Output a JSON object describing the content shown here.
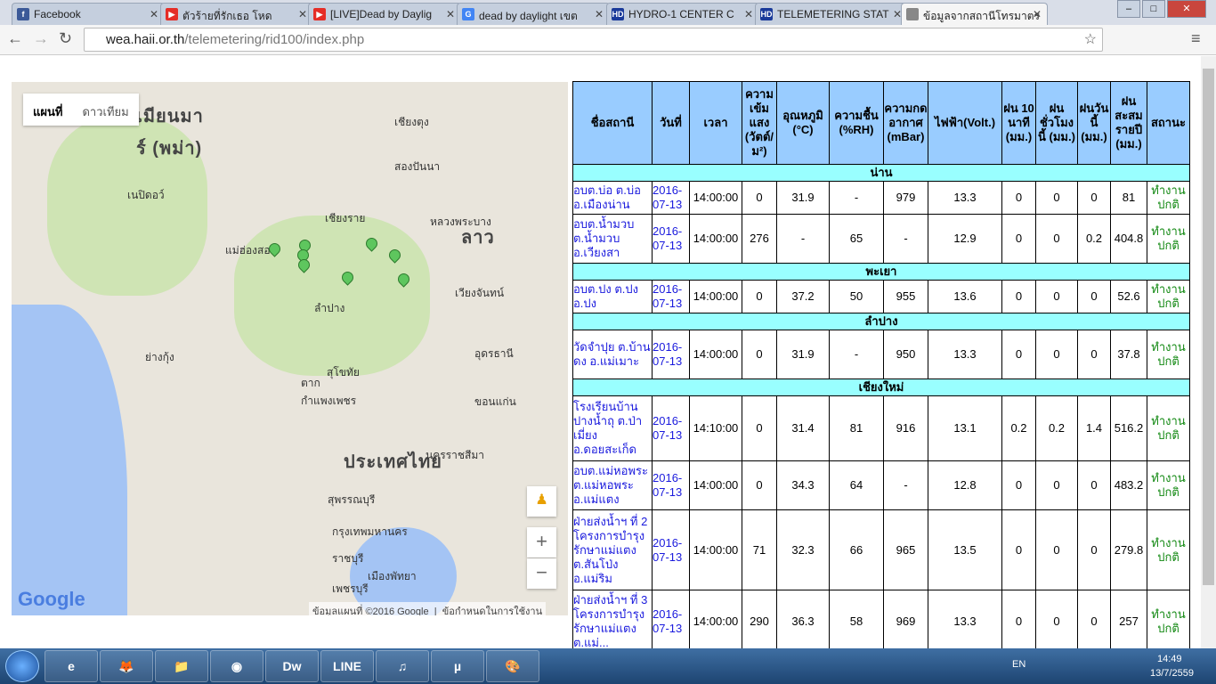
{
  "browser": {
    "tabs": [
      {
        "title": "Facebook",
        "icon": "facebook-icon",
        "color": "#3b5998",
        "glyph": "f"
      },
      {
        "title": "ตัวร้ายที่รักเธอ โหด",
        "icon": "youtube-icon",
        "color": "#e52d27",
        "glyph": "▶"
      },
      {
        "title": "[LIVE]Dead by Daylig",
        "icon": "youtube-icon",
        "color": "#e52d27",
        "glyph": "▶"
      },
      {
        "title": "dead by daylight เขต",
        "icon": "google-icon",
        "color": "#4285f4",
        "glyph": "G"
      },
      {
        "title": "HYDRO-1 CENTER C",
        "icon": "hd-one-icon",
        "color": "#1a3a9a",
        "glyph": "HD"
      },
      {
        "title": "TELEMETERING STAT",
        "icon": "hd-one-icon",
        "color": "#1a3a9a",
        "glyph": "HD"
      },
      {
        "title": "ข้อมูลจากสถานีโทรมาตร",
        "icon": "page-icon",
        "color": "#888888",
        "glyph": ""
      }
    ],
    "url_domain": "wea.haii.or.th",
    "url_path": "/telemetering/rid100/index.php"
  },
  "map": {
    "type_buttons": [
      "แผนที่",
      "ดาวเทียม"
    ],
    "labels": [
      {
        "t": "เมียนมา",
        "c": "big"
      },
      {
        "t": "ร์ (พม่า)",
        "c": "big"
      },
      {
        "t": "ลาว",
        "c": "big"
      },
      {
        "t": "ประเทศไทย",
        "c": "big"
      },
      {
        "t": "เนปิดอว์",
        "c": ""
      },
      {
        "t": "เชียงราย",
        "c": ""
      },
      {
        "t": "ลำปาง",
        "c": ""
      },
      {
        "t": "แม่ฮ่องสอน",
        "c": ""
      },
      {
        "t": "เวียงจันทน์",
        "c": ""
      },
      {
        "t": "อุดรธานี",
        "c": ""
      },
      {
        "t": "สุโขทัย",
        "c": ""
      },
      {
        "t": "ตาก",
        "c": ""
      },
      {
        "t": "กำแพงเพชร",
        "c": ""
      },
      {
        "t": "ขอนแก่น",
        "c": ""
      },
      {
        "t": "นครราชสีมา",
        "c": ""
      },
      {
        "t": "สุพรรณบุรี",
        "c": ""
      },
      {
        "t": "กรุงเทพมหานคร",
        "c": ""
      },
      {
        "t": "ราชบุรี",
        "c": ""
      },
      {
        "t": "เมืองพัทยา",
        "c": ""
      },
      {
        "t": "เพชรบุรี",
        "c": ""
      },
      {
        "t": "ย่างกุ้ง",
        "c": ""
      },
      {
        "t": "หลวงพระบาง",
        "c": ""
      },
      {
        "t": "เชียงตุง",
        "c": ""
      },
      {
        "t": "สองปันนา",
        "c": ""
      }
    ],
    "attribution": "ข้อมูลแผนที่ ©2016 Google",
    "terms": "ข้อกำหนดในการใช้งาน",
    "logo": "Google",
    "zoom_in": "+",
    "zoom_out": "−"
  },
  "table": {
    "headers": [
      "ชื่อสถานี",
      "วันที่",
      "เวลา",
      "ความเข้มแสง (วัตต์/ม²)",
      "อุณหภูมิ (°C)",
      "ความชื้น (%RH)",
      "ความกดอากาศ (mBar)",
      "ไฟฟ้า(Volt.)",
      "ฝน 10 นาที (มม.)",
      "ฝนชั่วโมงนี้ (มม.)",
      "ฝนวันนี้ (มม.)",
      "ฝนสะสมรายปี (มม.)",
      "สถานะ"
    ],
    "groups": [
      {
        "name": "น่าน",
        "rows": [
          [
            "อบต.บ่อ ต.บ่อ อ.เมืองน่าน",
            "2016-07-13",
            "14:00:00",
            "0",
            "31.9",
            "-",
            "979",
            "13.3",
            "0",
            "0",
            "0",
            "81",
            "ทำงานปกติ"
          ],
          [
            "อบต.น้ำมวบ ต.น้ำมวบ อ.เวียงสา",
            "2016-07-13",
            "14:00:00",
            "276",
            "-",
            "65",
            "-",
            "12.9",
            "0",
            "0",
            "0.2",
            "404.8",
            "ทำงานปกติ"
          ]
        ]
      },
      {
        "name": "พะเยา",
        "rows": [
          [
            "อบต.ปง ต.ปง อ.ปง",
            "2016-07-13",
            "14:00:00",
            "0",
            "37.2",
            "50",
            "955",
            "13.6",
            "0",
            "0",
            "0",
            "52.6",
            "ทำงานปกติ"
          ]
        ]
      },
      {
        "name": "ลำปาง",
        "rows": [
          [
            "วัดจำปุย ต.บ้านดง อ.แม่เมาะ",
            "2016-07-13",
            "14:00:00",
            "0",
            "31.9",
            "-",
            "950",
            "13.3",
            "0",
            "0",
            "0",
            "37.8",
            "ทำงานปกติ"
          ]
        ]
      },
      {
        "name": "เชียงใหม่",
        "rows": [
          [
            "โรงเรียนบ้านปางน้ำถุ ต.ป่าเมี่ยง อ.ดอยสะเก็ด",
            "2016-07-13",
            "14:10:00",
            "0",
            "31.4",
            "81",
            "916",
            "13.1",
            "0.2",
            "0.2",
            "1.4",
            "516.2",
            "ทำงานปกติ"
          ],
          [
            "อบต.แม่หอพระ ต.แม่หอพระ อ.แม่แตง",
            "2016-07-13",
            "14:00:00",
            "0",
            "34.3",
            "64",
            "-",
            "12.8",
            "0",
            "0",
            "0",
            "483.2",
            "ทำงานปกติ"
          ],
          [
            "ฝ่ายส่งน้ำฯ ที่ 2 โครงการบำรุงรักษาแม่แตง ต.สันโป่ง อ.แม่ริม",
            "2016-07-13",
            "14:00:00",
            "71",
            "32.3",
            "66",
            "965",
            "13.5",
            "0",
            "0",
            "0",
            "279.8",
            "ทำงานปกติ"
          ],
          [
            "ฝ่ายส่งน้ำฯ ที่ 3 โครงการบำรุงรักษาแม่แตง ต.แม่...",
            "2016-07-13",
            "14:00:00",
            "290",
            "36.3",
            "58",
            "969",
            "13.3",
            "0",
            "0",
            "0",
            "257",
            "ทำงานปกติ"
          ]
        ]
      }
    ]
  },
  "taskbar": {
    "apps": [
      {
        "n": "ie",
        "g": "e"
      },
      {
        "n": "firefox",
        "g": "🦊"
      },
      {
        "n": "explorer",
        "g": "📁"
      },
      {
        "n": "chrome",
        "g": "◉"
      },
      {
        "n": "dreamweaver",
        "g": "Dw"
      },
      {
        "n": "line",
        "g": "LINE"
      },
      {
        "n": "itunes",
        "g": "♫"
      },
      {
        "n": "utorrent",
        "g": "µ"
      },
      {
        "n": "paint",
        "g": "🎨"
      }
    ],
    "lang": "EN",
    "time": "14:49",
    "date": "13/7/2559"
  }
}
